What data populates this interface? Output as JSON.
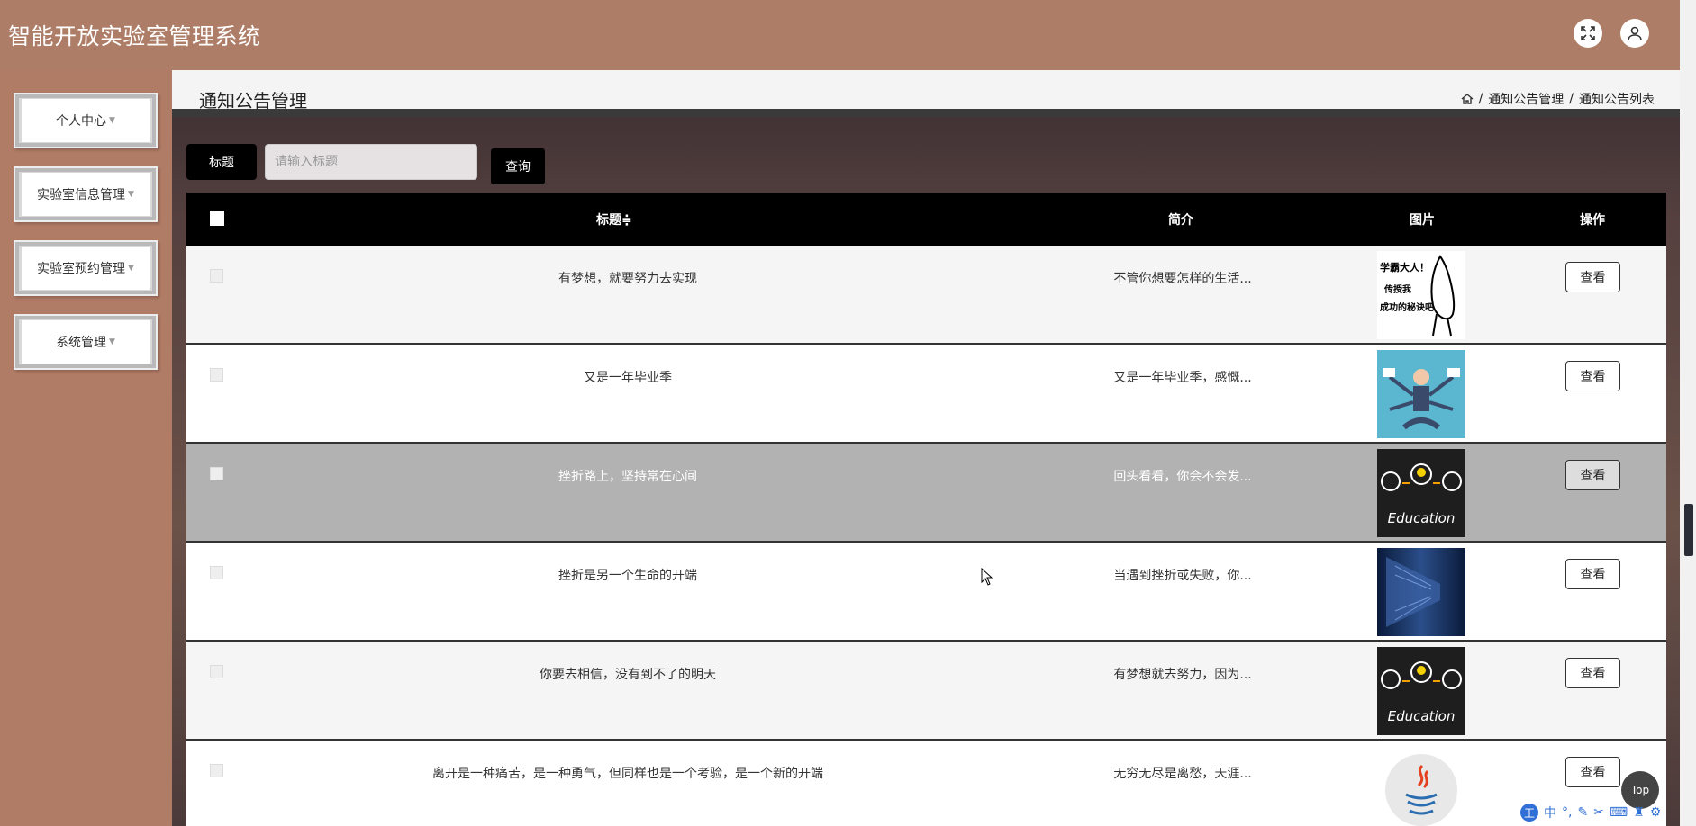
{
  "app": {
    "title": "智能开放实验室管理系统"
  },
  "header_icons": [
    "expand-icon",
    "user-icon"
  ],
  "sidebar": {
    "items": [
      {
        "label": "个人中心"
      },
      {
        "label": "实验室信息管理"
      },
      {
        "label": "实验室预约管理"
      },
      {
        "label": "系统管理"
      }
    ]
  },
  "page": {
    "title": "通知公告管理",
    "breadcrumb": [
      "通知公告管理",
      "通知公告列表"
    ]
  },
  "search": {
    "label": "标题",
    "placeholder": "请输入标题",
    "button": "查询"
  },
  "table": {
    "columns": {
      "title": "标题",
      "sort_mark": "≑",
      "summary": "简介",
      "image": "图片",
      "action": "操作"
    },
    "rows": [
      {
        "title": "有梦想，就要努力去实现",
        "summary": "不管你想要怎样的生活...",
        "action": "查看",
        "thumb_text": [
          "学霸大人！",
          "传授我",
          "成功的秘诀吧"
        ]
      },
      {
        "title": "又是一年毕业季",
        "summary": "又是一年毕业季，感慨...",
        "action": "查看"
      },
      {
        "title": "挫折路上，坚持常在心间",
        "summary": "回头看看，你会不会发...",
        "action": "查看",
        "thumb_text": [
          "Education"
        ]
      },
      {
        "title": "挫折是另一个生命的开端",
        "summary": "当遇到挫折或失败，你...",
        "action": "查看"
      },
      {
        "title": "你要去相信，没有到不了的明天",
        "summary": "有梦想就去努力，因为...",
        "action": "查看",
        "thumb_text": [
          "Education"
        ]
      },
      {
        "title": "离开是一种痛苦，是一种勇气，但同样也是一个考验，是一个新的开端",
        "summary": "无穷无尽是离愁，天涯...",
        "action": "查看"
      }
    ]
  },
  "float": {
    "top": "Top"
  },
  "ime": {
    "lang": "中"
  },
  "colors": {
    "header_bg": "#ae7d67",
    "table_head": "#000000",
    "hover_row": "#b2b2b2"
  }
}
